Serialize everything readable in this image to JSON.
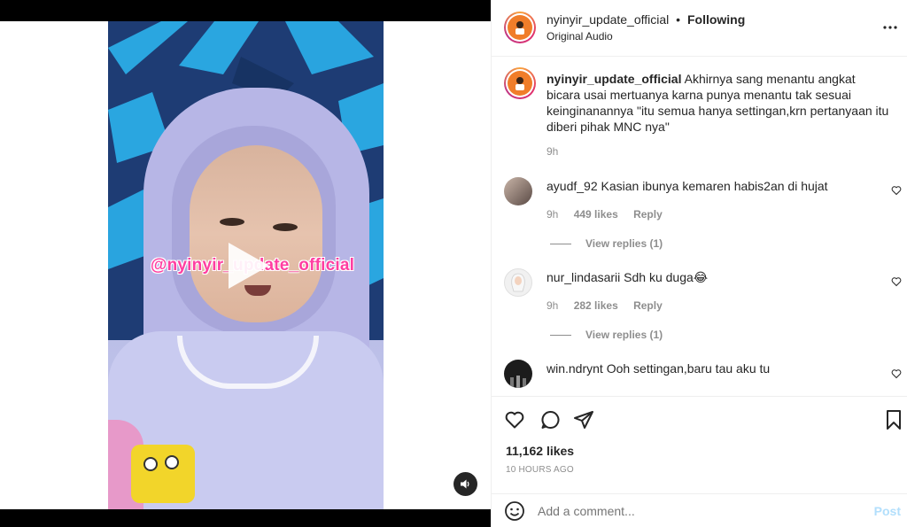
{
  "post": {
    "username": "nyinyir_update_official",
    "follow_separator": "•",
    "follow_status": "Following",
    "audio": "Original Audio",
    "more_icon": "more-horizontal-icon"
  },
  "video": {
    "watermark": "@nyinyir_update_official"
  },
  "caption": {
    "username": "nyinyir_update_official",
    "text": "Akhirnya sang menantu angkat bicara usai mertuanya karna punya menantu tak sesuai keinginanannya \"itu semua hanya settingan,krn pertanyaan itu diberi pihak MNC nya\"",
    "time": "9h"
  },
  "comments": [
    {
      "username": "ayudf_92",
      "text": "Kasian ibunya kemaren habis2an di hujat",
      "time": "9h",
      "likes": "449 likes",
      "reply": "Reply",
      "view_replies": "View replies (1)"
    },
    {
      "username": "nur_lindasarii",
      "text": "Sdh ku duga😂",
      "time": "9h",
      "likes": "282 likes",
      "reply": "Reply",
      "view_replies": "View replies (1)"
    },
    {
      "username": "win.ndrynt",
      "text": "Ooh settingan,baru tau aku tu"
    }
  ],
  "stats": {
    "likes": "11,162 likes",
    "posted": "10 HOURS AGO"
  },
  "add_comment": {
    "placeholder": "Add a comment...",
    "post_label": "Post"
  },
  "colors": {
    "accent": "#0095f6",
    "post_disabled": "#b2dffc",
    "text": "#262626",
    "muted": "#8e8e8e",
    "watermark": "#ff3ea1"
  }
}
